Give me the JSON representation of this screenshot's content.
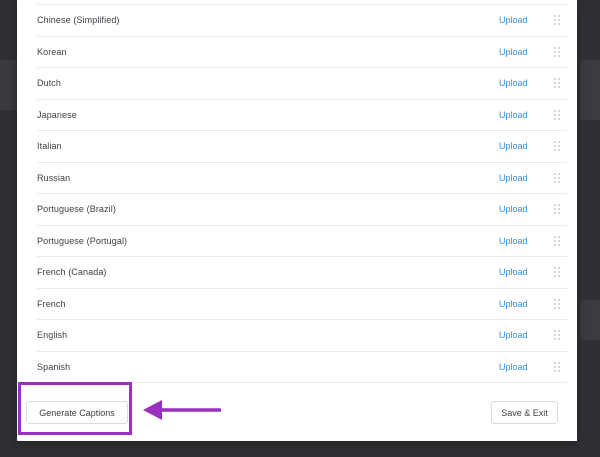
{
  "languages": [
    {
      "name": "Chinese (Simplified)",
      "action": "Upload"
    },
    {
      "name": "Korean",
      "action": "Upload"
    },
    {
      "name": "Dutch",
      "action": "Upload"
    },
    {
      "name": "Japanese",
      "action": "Upload"
    },
    {
      "name": "Italian",
      "action": "Upload"
    },
    {
      "name": "Russian",
      "action": "Upload"
    },
    {
      "name": "Portuguese (Brazil)",
      "action": "Upload"
    },
    {
      "name": "Portuguese (Portugal)",
      "action": "Upload"
    },
    {
      "name": "French (Canada)",
      "action": "Upload"
    },
    {
      "name": "French",
      "action": "Upload"
    },
    {
      "name": "English",
      "action": "Upload"
    },
    {
      "name": "Spanish",
      "action": "Upload"
    }
  ],
  "footer": {
    "generate_label": "Generate Captions",
    "save_exit_label": "Save & Exit"
  },
  "icons": {
    "row_handle": "drag-handle-icon",
    "annotation_arrow": "arrow-left-icon"
  },
  "colors": {
    "link": "#2f8fe0",
    "highlight": "#9b2fc0",
    "backdrop": "#2f3033"
  }
}
